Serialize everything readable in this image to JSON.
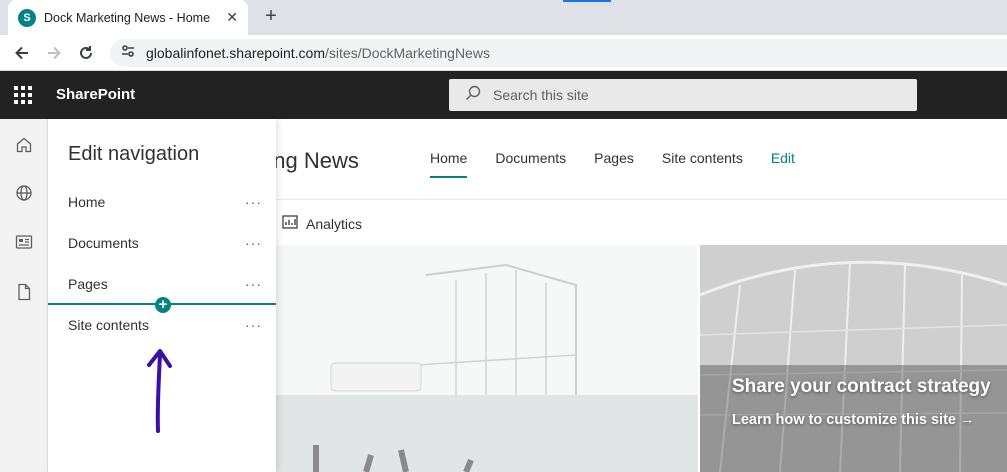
{
  "browser": {
    "tab_title": "Dock Marketing News - Home",
    "favicon_letter": "S",
    "url_host": "globalinfonet.sharepoint.com",
    "url_path": "/sites/DockMarketingNews"
  },
  "suitebar": {
    "brand": "SharePoint",
    "search_placeholder": "Search this site"
  },
  "site": {
    "title": "eting News",
    "topnav": [
      {
        "label": "Home",
        "active": true
      },
      {
        "label": "Documents"
      },
      {
        "label": "Pages"
      },
      {
        "label": "Site contents"
      },
      {
        "label": "Edit"
      }
    ],
    "analytics_label": "Analytics"
  },
  "hero": {
    "title": "Share your contract strategy",
    "link": "Learn how to customize this site →"
  },
  "edit_navigation": {
    "title": "Edit navigation",
    "items": [
      {
        "label": "Home",
        "more": "···"
      },
      {
        "label": "Documents",
        "more": "···"
      },
      {
        "label": "Pages",
        "more": "···"
      },
      {
        "label": "Site contents",
        "more": "···"
      }
    ],
    "insert_symbol": "+"
  },
  "colors": {
    "accent": "#038387",
    "suitebar_bg": "#222222",
    "annotation_arrow": "#3b0fa8"
  }
}
